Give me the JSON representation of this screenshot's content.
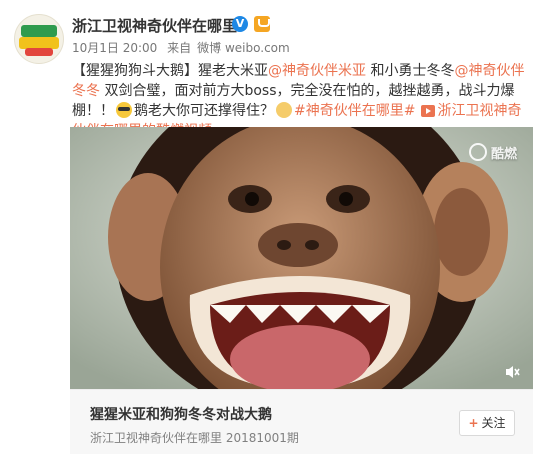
{
  "author": {
    "name": "浙江卫视神奇伙伴在哪里",
    "verified_badge": "V",
    "verified_color": "#1e88e5"
  },
  "post_meta": {
    "date": "10月1日 20:00",
    "source_prefix": "来自",
    "source": "微博 weibo.com"
  },
  "post_text": {
    "part1": "【猩猩狗狗斗大鹅】猩老大米亚",
    "mention1": "@神奇伙伴米亚",
    "part2": " 和小勇士冬冬",
    "mention2": "@神奇伙伴冬冬",
    "part3": " 双剑合璧，面对前方大boss，完全没在怕的，越挫越勇，战斗力爆棚！！",
    "part4": "鹅老大你可还撑得住？",
    "hashtag": "#神奇伙伴在哪里#",
    "video_link": "浙江卫视神奇伙伴在哪里的酷燃视频"
  },
  "media": {
    "watermark": "酷燃"
  },
  "card": {
    "title": "猩猩米亚和狗狗冬冬对战大鹅",
    "subtitle": "浙江卫视神奇伙伴在哪里 20181001期",
    "follow_label": "关注",
    "follow_plus": "+"
  },
  "colors": {
    "link": "#eb7350",
    "card_bg": "#f7f7f7"
  }
}
